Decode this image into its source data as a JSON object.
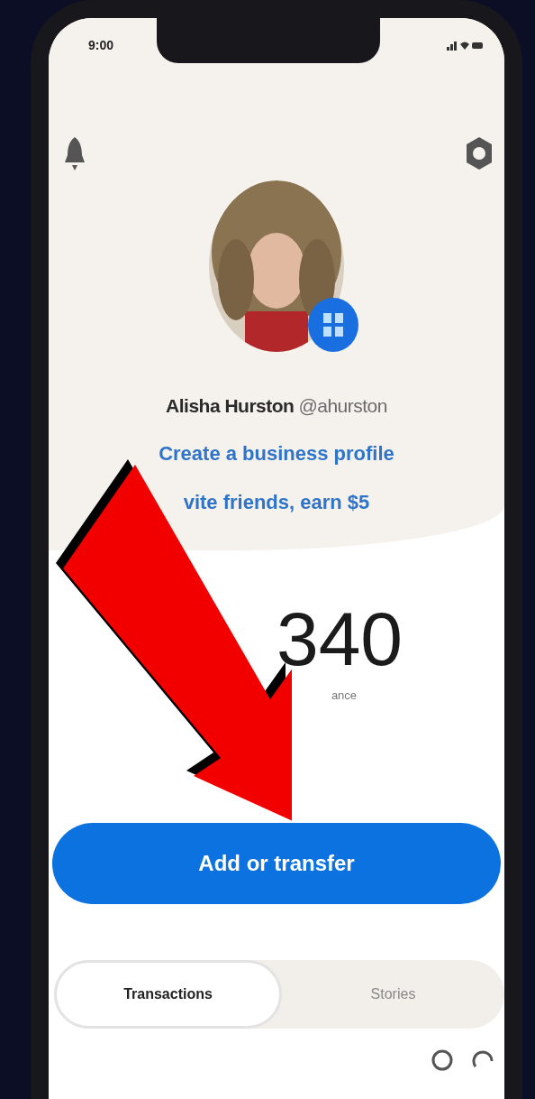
{
  "status_bar": {
    "time": "9:00"
  },
  "profile": {
    "name": "Alisha Hurston",
    "handle": "@ahurston"
  },
  "links": [
    "Create a business profile",
    "vite friends, earn $5"
  ],
  "balance": {
    "amount": "340",
    "label": "ance"
  },
  "primary_button": {
    "label": "Add or transfer"
  },
  "tabs": [
    {
      "label": "Transactions",
      "selected": true
    },
    {
      "label": "Stories",
      "selected": false
    }
  ]
}
